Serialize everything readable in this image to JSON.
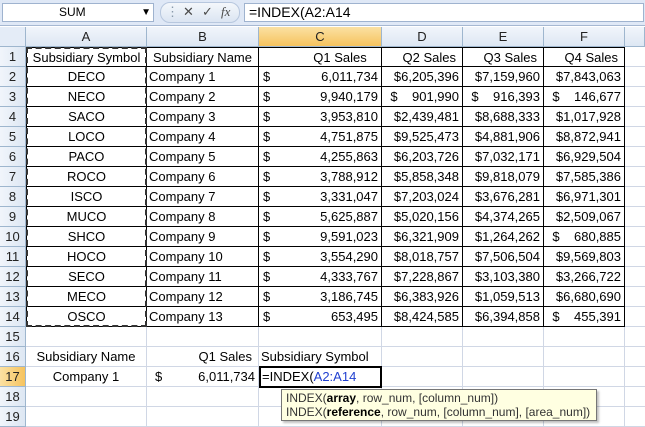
{
  "formula_bar": {
    "name_box": "SUM",
    "cancel_icon": "✕",
    "enter_icon": "✓",
    "fx_icon": "fx",
    "formula": "=INDEX(A2:A14"
  },
  "columns": [
    "A",
    "B",
    "C",
    "D",
    "E",
    "F"
  ],
  "rows": [
    "1",
    "2",
    "3",
    "4",
    "5",
    "6",
    "7",
    "8",
    "9",
    "10",
    "11",
    "12",
    "13",
    "14",
    "15",
    "16",
    "17",
    "18",
    "19"
  ],
  "table": {
    "headers": [
      "Subsidiary Symbol",
      "Subsidiary Name",
      "Q1 Sales",
      "Q2 Sales",
      "Q3 Sales",
      "Q4 Sales"
    ],
    "data": [
      [
        "DECO",
        "Company 1",
        "$",
        "6,011,734",
        "$6,205,396",
        "$7,159,960",
        "$7,843,063"
      ],
      [
        "NECO",
        "Company 2",
        "$",
        "9,940,179",
        "$    901,990",
        "$    916,393",
        "$    146,677"
      ],
      [
        "SACO",
        "Company 3",
        "$",
        "3,953,810",
        "$2,439,481",
        "$8,688,333",
        "$1,017,928"
      ],
      [
        "LOCO",
        "Company 4",
        "$",
        "4,751,875",
        "$9,525,473",
        "$4,881,906",
        "$8,872,941"
      ],
      [
        "PACO",
        "Company 5",
        "$",
        "4,255,863",
        "$6,203,726",
        "$7,032,171",
        "$6,929,504"
      ],
      [
        "ROCO",
        "Company 6",
        "$",
        "3,788,912",
        "$5,858,348",
        "$9,818,079",
        "$7,585,386"
      ],
      [
        "ISCO",
        "Company 7",
        "$",
        "3,331,047",
        "$7,203,024",
        "$3,676,281",
        "$6,971,301"
      ],
      [
        "MUCO",
        "Company 8",
        "$",
        "5,625,887",
        "$5,020,156",
        "$4,374,265",
        "$2,509,067"
      ],
      [
        "SHCO",
        "Company 9",
        "$",
        "9,591,023",
        "$6,321,909",
        "$1,264,262",
        "$    680,885"
      ],
      [
        "HOCO",
        "Company 10",
        "$",
        "3,554,290",
        "$8,018,757",
        "$7,506,504",
        "$9,569,803"
      ],
      [
        "SECO",
        "Company 11",
        "$",
        "4,333,767",
        "$7,228,867",
        "$3,103,380",
        "$3,266,722"
      ],
      [
        "MECO",
        "Company 12",
        "$",
        "3,186,745",
        "$6,383,926",
        "$1,059,513",
        "$6,680,690"
      ],
      [
        "OSCO",
        "Company 13",
        "$",
        "653,495",
        "$8,424,585",
        "$6,394,858",
        "$    455,391"
      ]
    ]
  },
  "lookup": {
    "headers": [
      "Subsidiary Name",
      "Q1 Sales",
      "Subsidiary Symbol"
    ],
    "name": "Company 1",
    "q1_symbol": "$",
    "q1_value": "6,011,734",
    "edit_prefix": "=INDEX(",
    "edit_ref": "A2:A14"
  },
  "tooltip": {
    "line1_fn": "INDEX(",
    "line1_arg": "array",
    "line1_rest": ", row_num, [column_num])",
    "line2_fn": "INDEX(",
    "line2_arg": "reference",
    "line2_rest": ", row_num, [column_num], [area_num])"
  }
}
